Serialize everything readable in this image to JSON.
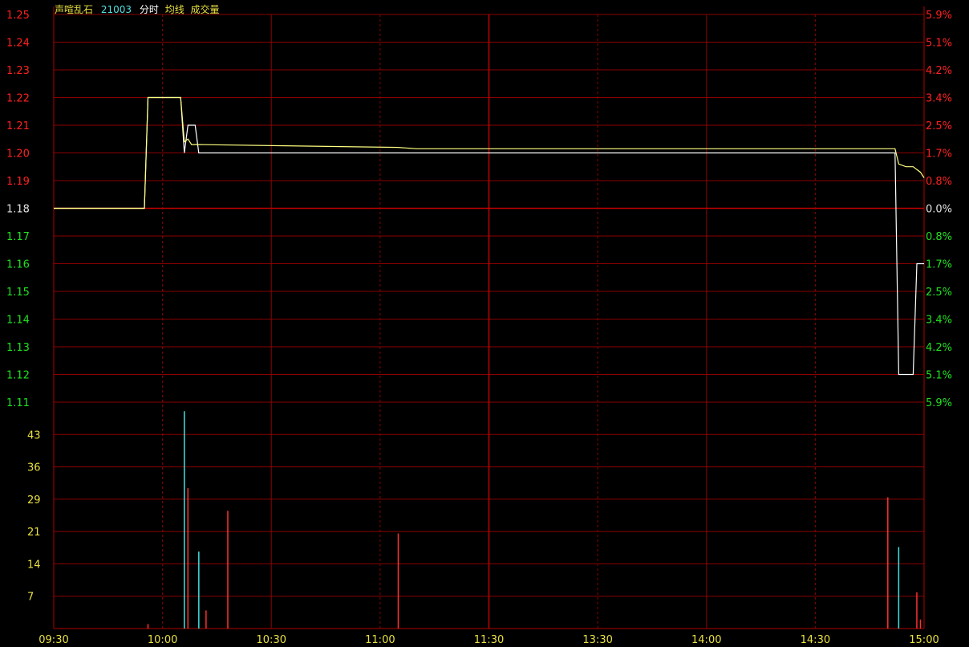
{
  "header": {
    "stock_name": "声喧乱石",
    "stock_code": "21003",
    "indicators": [
      "分时",
      "均线",
      "成交量"
    ]
  },
  "colors": {
    "background": "#000000",
    "grid": "#8b0000",
    "axis": "#b00000",
    "up": "#ff2020",
    "down": "#20e020",
    "neutral": "#e0e0e0",
    "price_line": "#ffffff",
    "avg_line": "#ffff80",
    "volume_label": "#e8e040",
    "name_text": "#e8e040",
    "code_text": "#50e0e0",
    "time_text": "#e8e040",
    "volume_up": "#ff3030",
    "volume_down": "#40e0e0",
    "volume_flat": "#c0c0c0"
  },
  "chart_data": {
    "type": "line",
    "price_axis": {
      "ticks": [
        "1.25",
        "1.24",
        "1.23",
        "1.22",
        "1.21",
        "1.20",
        "1.19",
        "1.18",
        "1.17",
        "1.16",
        "1.15",
        "1.14",
        "1.13",
        "1.12",
        "1.11"
      ],
      "ylim": [
        1.11,
        1.25
      ],
      "prev_close": 1.18
    },
    "percent_axis": {
      "ticks": [
        "5.9%",
        "5.1%",
        "4.2%",
        "3.4%",
        "2.5%",
        "1.7%",
        "0.8%",
        "0.0%",
        "0.8%",
        "1.7%",
        "2.5%",
        "3.4%",
        "4.2%",
        "5.1%",
        "5.9%"
      ]
    },
    "volume_axis": {
      "ticks": [
        "43",
        "36",
        "29",
        "21",
        "14",
        "7"
      ],
      "ylim": [
        0,
        50
      ]
    },
    "time_axis": {
      "labels": [
        "09:30",
        "10:00",
        "10:30",
        "11:00",
        "11:30",
        "13:30",
        "14:00",
        "14:30",
        "15:00"
      ],
      "total_minutes": 240
    },
    "series": [
      {
        "id": "price",
        "points": [
          [
            0,
            1.18
          ],
          [
            25,
            1.18
          ],
          [
            26,
            1.22
          ],
          [
            35,
            1.22
          ],
          [
            36,
            1.2
          ],
          [
            37,
            1.21
          ],
          [
            39,
            1.21
          ],
          [
            40,
            1.2
          ],
          [
            232,
            1.2
          ],
          [
            233,
            1.12
          ],
          [
            237,
            1.12
          ],
          [
            238,
            1.16
          ],
          [
            240,
            1.16
          ]
        ]
      },
      {
        "id": "avg",
        "points": [
          [
            0,
            1.18
          ],
          [
            25,
            1.18
          ],
          [
            26,
            1.22
          ],
          [
            35,
            1.22
          ],
          [
            36,
            1.204
          ],
          [
            37,
            1.205
          ],
          [
            38,
            1.203
          ],
          [
            40,
            1.203
          ],
          [
            95,
            1.202
          ],
          [
            100,
            1.2015
          ],
          [
            232,
            1.2015
          ],
          [
            233,
            1.196
          ],
          [
            235,
            1.195
          ],
          [
            237,
            1.195
          ],
          [
            239,
            1.193
          ],
          [
            240,
            1.191
          ]
        ]
      }
    ],
    "volume": [
      {
        "t": 26,
        "v": 1,
        "dir": "up"
      },
      {
        "t": 36,
        "v": 48,
        "dir": "down"
      },
      {
        "t": 37,
        "v": 31,
        "dir": "up"
      },
      {
        "t": 40,
        "v": 17,
        "dir": "down"
      },
      {
        "t": 42,
        "v": 4,
        "dir": "up"
      },
      {
        "t": 48,
        "v": 26,
        "dir": "up"
      },
      {
        "t": 95,
        "v": 21,
        "dir": "up"
      },
      {
        "t": 230,
        "v": 29,
        "dir": "up"
      },
      {
        "t": 233,
        "v": 18,
        "dir": "down"
      },
      {
        "t": 238,
        "v": 8,
        "dir": "up"
      },
      {
        "t": 239,
        "v": 2,
        "dir": "up"
      }
    ]
  }
}
